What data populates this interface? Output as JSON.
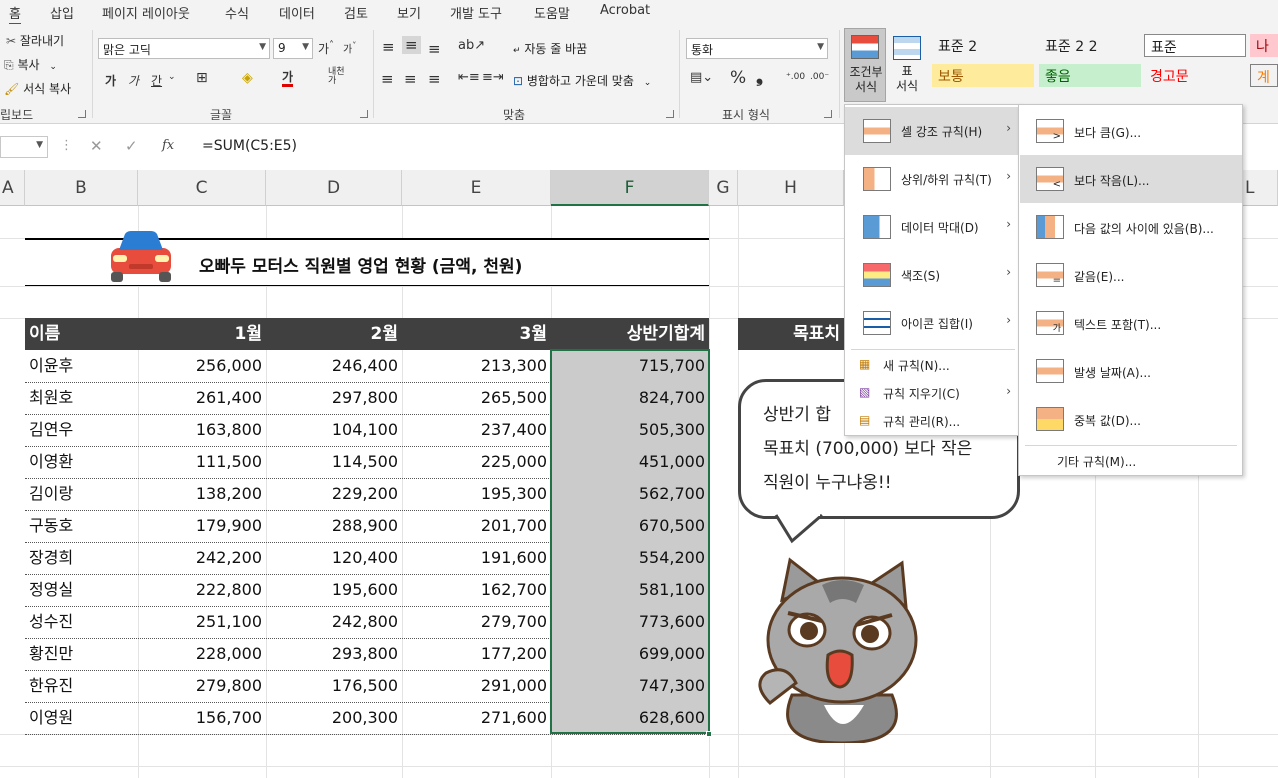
{
  "tabs": [
    "홈",
    "삽입",
    "페이지 레이아웃",
    "수식",
    "데이터",
    "검토",
    "보기",
    "개발 도구",
    "도움말",
    "Acrobat"
  ],
  "ribbon": {
    "clipboard": {
      "cut": "잘라내기",
      "copy": "복사",
      "format_painter": "서식 복사",
      "label": "립보드"
    },
    "font": {
      "name": "맑은 고딕",
      "size": "9",
      "label": "글꼴"
    },
    "alignment": {
      "wrap": "자동 줄 바꿈",
      "merge": "병합하고 가운데 맞춤",
      "label": "맞춤"
    },
    "number": {
      "format": "통화",
      "label": "표시 형식"
    },
    "cond_format": "조건부\n서식",
    "table_format": "표\n서식",
    "styles": {
      "s1": "표준 2",
      "s2": "표준 2 2",
      "s3": "표준",
      "s4": "나쁨",
      "s5": "보통",
      "s6": "좋음",
      "s7": "경고문",
      "s8": "계산"
    }
  },
  "formula_bar": {
    "formula": "=SUM(C5:E5)",
    "fx": "fx"
  },
  "columns": [
    "A",
    "B",
    "C",
    "D",
    "E",
    "F",
    "G",
    "H",
    "L"
  ],
  "sheet": {
    "title": "오빠두 모터스 직원별 영업 현황 (금액, 천원)",
    "headers": [
      "이름",
      "1월",
      "2월",
      "3월",
      "상반기합계"
    ],
    "target_label": "목표치",
    "rows": [
      [
        "이윤후",
        "256,000",
        "246,400",
        "213,300",
        "715,700"
      ],
      [
        "최원호",
        "261,400",
        "297,800",
        "265,500",
        "824,700"
      ],
      [
        "김연우",
        "163,800",
        "104,100",
        "237,400",
        "505,300"
      ],
      [
        "이영환",
        "111,500",
        "114,500",
        "225,000",
        "451,000"
      ],
      [
        "김이랑",
        "138,200",
        "229,200",
        "195,300",
        "562,700"
      ],
      [
        "구동호",
        "179,900",
        "288,900",
        "201,700",
        "670,500"
      ],
      [
        "장경희",
        "242,200",
        "120,400",
        "191,600",
        "554,200"
      ],
      [
        "정영실",
        "222,800",
        "195,600",
        "162,700",
        "581,100"
      ],
      [
        "성수진",
        "251,100",
        "242,800",
        "279,700",
        "773,600"
      ],
      [
        "황진만",
        "228,000",
        "293,800",
        "177,200",
        "699,000"
      ],
      [
        "한유진",
        "279,800",
        "176,500",
        "291,000",
        "747,300"
      ],
      [
        "이영원",
        "156,700",
        "200,300",
        "271,600",
        "628,600"
      ]
    ]
  },
  "menu1": {
    "items": [
      {
        "label": "셀 강조 규칙(H)"
      },
      {
        "label": "상위/하위 규칙(T)"
      },
      {
        "label": "데이터 막대(D)"
      },
      {
        "label": "색조(S)"
      },
      {
        "label": "아이콘 집합(I)"
      }
    ],
    "small": [
      {
        "label": "새 규칙(N)..."
      },
      {
        "label": "규칙 지우기(C)"
      },
      {
        "label": "규칙 관리(R)..."
      }
    ]
  },
  "menu2": {
    "items": [
      {
        "label": "보다 큼(G)..."
      },
      {
        "label": "보다 작음(L)..."
      },
      {
        "label": "다음 값의 사이에 있음(B)..."
      },
      {
        "label": "같음(E)..."
      },
      {
        "label": "텍스트 포함(T)..."
      },
      {
        "label": "발생 날짜(A)..."
      },
      {
        "label": "중복 값(D)..."
      }
    ],
    "more": "기타 규칙(M)..."
  },
  "bubble": {
    "line1": "상반기 합",
    "line2": "목표치 (700,000) 보다 작은",
    "line3": "직원이 누구냐옹!!"
  },
  "colors": {
    "accent": "#217346",
    "header_bg": "#404040",
    "highlight": "#cbcbcb"
  }
}
